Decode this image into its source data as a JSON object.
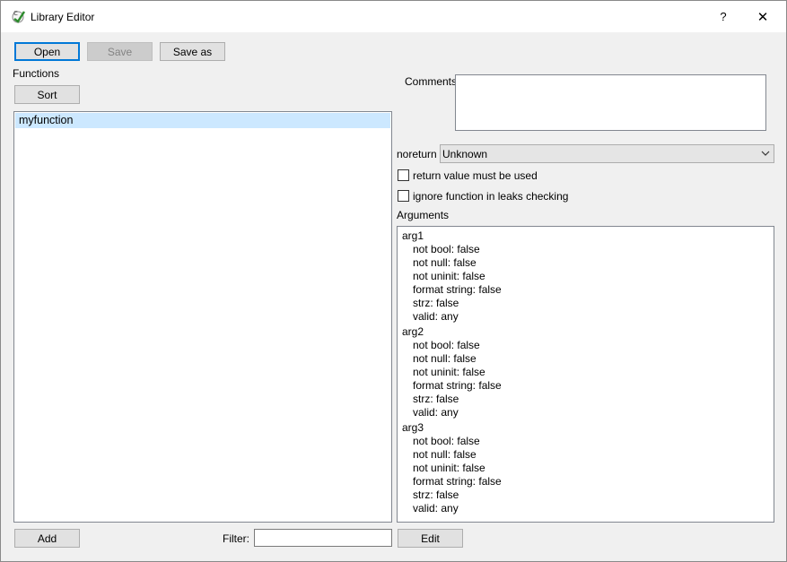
{
  "window": {
    "title": "Library Editor",
    "help_label": "?",
    "close_label": "✕"
  },
  "toolbar": {
    "open_label": "Open",
    "save_label": "Save",
    "saveas_label": "Save as"
  },
  "functions": {
    "label": "Functions",
    "sort_label": "Sort",
    "items": [
      "myfunction"
    ],
    "add_label": "Add"
  },
  "filter": {
    "label": "Filter:",
    "value": ""
  },
  "comments": {
    "label": "Comments",
    "value": ""
  },
  "noreturn": {
    "label": "noreturn",
    "selected": "Unknown"
  },
  "checkboxes": {
    "return_value": {
      "label": "return value must be used",
      "checked": false
    },
    "ignore_leaks": {
      "label": "ignore function in leaks checking",
      "checked": false
    }
  },
  "arguments": {
    "label": "Arguments",
    "edit_label": "Edit",
    "lines": [
      "arg1",
      "not bool: false",
      "not null: false",
      "not uninit: false",
      "format string: false",
      "strz: false",
      "valid: any",
      "arg2",
      "not bool: false",
      "not null: false",
      "not uninit: false",
      "format string: false",
      "strz: false",
      "valid: any",
      "arg3",
      "not bool: false",
      "not null: false",
      "not uninit: false",
      "format string: false",
      "strz: false",
      "valid: any"
    ]
  },
  "icons": {
    "app": "cppcheck-icon",
    "dropdown": "chevron-down-icon"
  },
  "colors": {
    "selection": "#cce8ff",
    "focus_border": "#0078d7"
  }
}
